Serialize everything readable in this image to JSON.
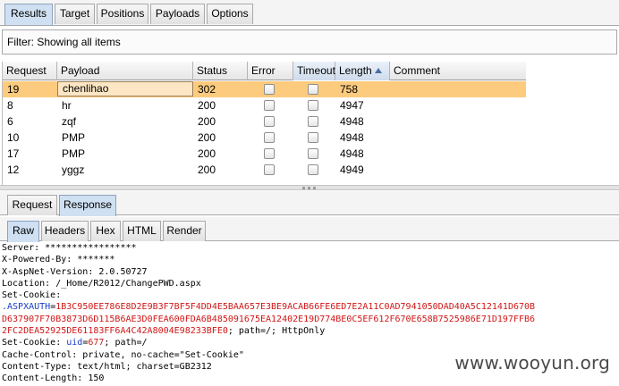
{
  "top_tabs": [
    "Results",
    "Target",
    "Positions",
    "Payloads",
    "Options"
  ],
  "active_top_tab": "Results",
  "filter": {
    "text": "Filter: Showing all items"
  },
  "table": {
    "columns": [
      "Request",
      "Payload",
      "Status",
      "Error",
      "Timeout",
      "Length",
      "Comment"
    ],
    "sorted_column": "Length",
    "rows": [
      {
        "request": "19",
        "payload": "chenlihao",
        "status": "302",
        "error": false,
        "timeout": false,
        "length": "758",
        "comment": "",
        "selected": true
      },
      {
        "request": "8",
        "payload": "hr",
        "status": "200",
        "error": false,
        "timeout": false,
        "length": "4947",
        "comment": ""
      },
      {
        "request": "6",
        "payload": "zqf",
        "status": "200",
        "error": false,
        "timeout": false,
        "length": "4948",
        "comment": ""
      },
      {
        "request": "10",
        "payload": "PMP",
        "status": "200",
        "error": false,
        "timeout": false,
        "length": "4948",
        "comment": ""
      },
      {
        "request": "17",
        "payload": "PMP",
        "status": "200",
        "error": false,
        "timeout": false,
        "length": "4948",
        "comment": ""
      },
      {
        "request": "12",
        "payload": "yggz",
        "status": "200",
        "error": false,
        "timeout": false,
        "length": "4949",
        "comment": ""
      }
    ]
  },
  "mid_tabs": [
    "Request",
    "Response"
  ],
  "active_mid_tab": "Response",
  "view_tabs": [
    "Raw",
    "Headers",
    "Hex",
    "HTML",
    "Render"
  ],
  "active_view_tab": "Raw",
  "response": {
    "server": "Server: *****************",
    "powered_by": "X-Powered-By: *******",
    "aspnet_version": "X-AspNet-Version: 2.0.50727",
    "location": "Location: /_Home/R2012/ChangePWD.aspx",
    "set_cookie_1": "Set-Cookie:",
    "aspxauth_name": ".ASPXAUTH",
    "aspxauth_eq": "=",
    "aspxauth_1": "1B3C950EE786E8D2E9B3F7BF5F4DD4E5BAA657E3BE9ACAB66FE6ED7E2A11C0AD7941050DAD40A5C12141D670B",
    "aspxauth_2": "D637907F70B3873D6D115B6AE3D0FEA600FDA6B485091675EA12402E19D774BE0C5EF612F670E658B7525986E71D197FFB6",
    "aspxauth_3": "2FC2DEA52925DE61183FF6A4C42A8004E98233BFE0",
    "aspxauth_tail": "; path=/; HttpOnly",
    "set_cookie_2_prefix": "Set-Cookie: ",
    "uid_name": "uid",
    "uid_eq": "=",
    "uid_value": "677",
    "uid_tail": "; path=/",
    "cache_control": "Cache-Control: private, no-cache=\"Set-Cookie\"",
    "content_type": "Content-Type: text/html; charset=GB2312",
    "content_length": "Content-Length: 150"
  },
  "watermark": "www.wooyun.org"
}
